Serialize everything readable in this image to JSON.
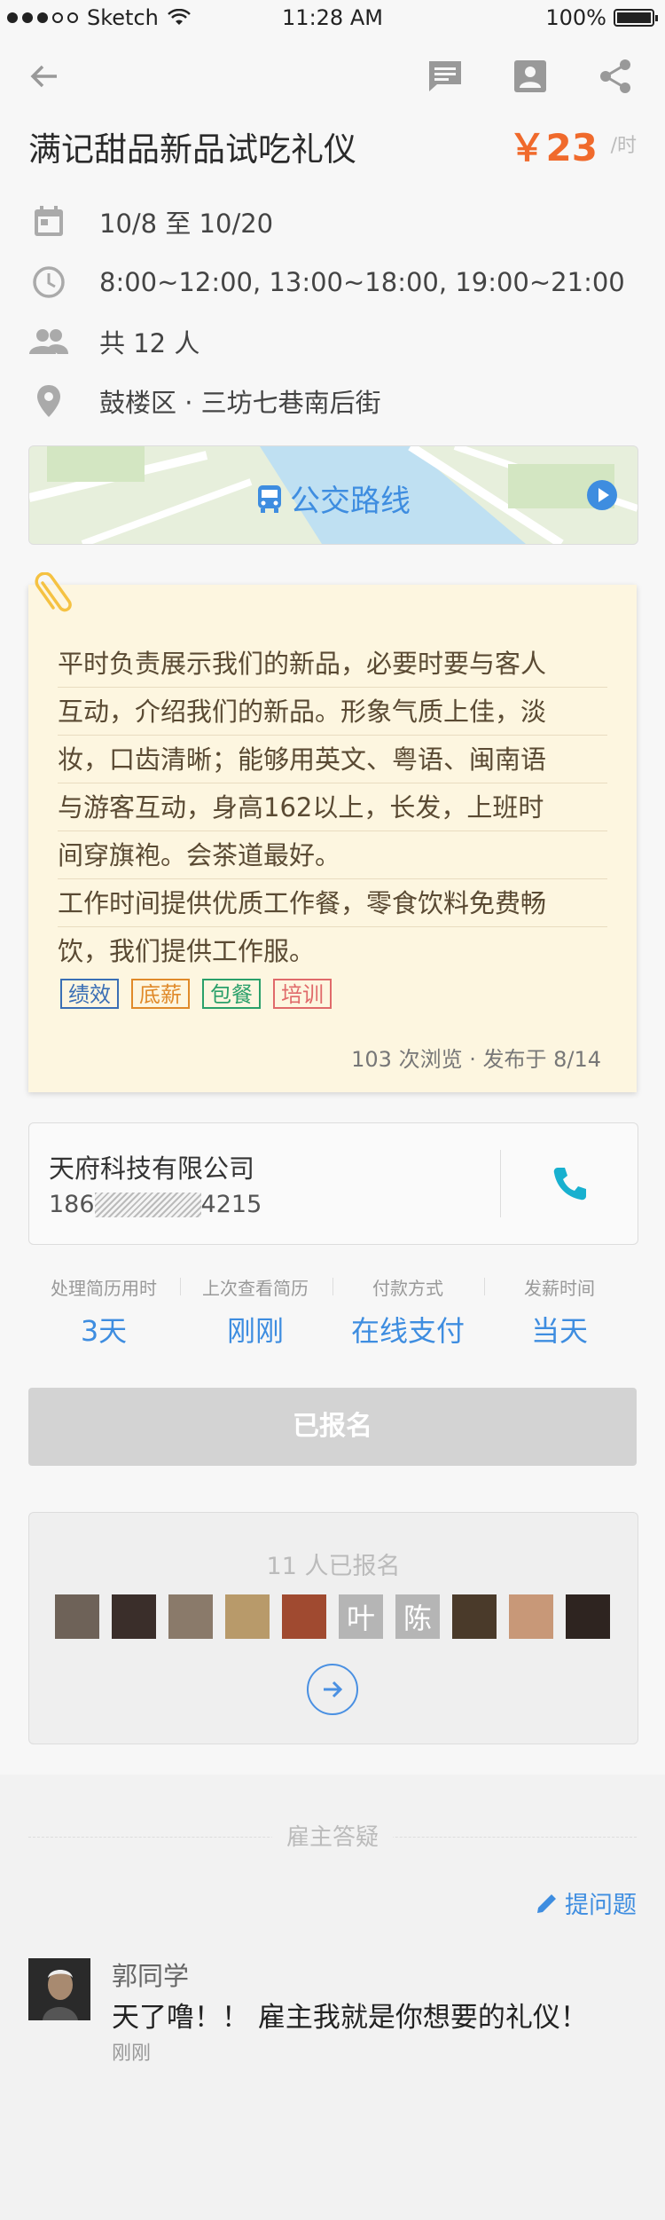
{
  "status_bar": {
    "carrier": "Sketch",
    "time": "11:28 AM",
    "battery": "100%"
  },
  "navbar": {
    "icons": [
      "back-icon",
      "message-icon",
      "contact-icon",
      "share-icon"
    ]
  },
  "job": {
    "title": "满记甜品新品试吃礼仪",
    "price": "￥23",
    "price_unit": "/时",
    "date_range": "10/8 至 10/20",
    "hours": "8:00~12:00, 13:00~18:00, 19:00~21:00",
    "headcount": "共 12 人",
    "location": "鼓楼区 · 三坊七巷南后街"
  },
  "map": {
    "label": "公交路线"
  },
  "description": {
    "lines": [
      "平时负责展示我们的新品，必要时要与客人",
      "互动，介绍我们的新品。形象气质上佳，淡",
      "妆，口齿清晰；能够用英文、粤语、闽南语",
      "与游客互动，身高162以上，长发，上班时",
      "间穿旗袍。会茶道最好。",
      "工作时间提供优质工作餐，零食饮料免费畅",
      "饮，我们提供工作服。"
    ],
    "tags": [
      {
        "label": "绩效",
        "color": "#3a6fb5"
      },
      {
        "label": "底薪",
        "color": "#e08a2a"
      },
      {
        "label": "包餐",
        "color": "#2aa06a"
      },
      {
        "label": "培训",
        "color": "#e06a6a"
      }
    ],
    "meta": "103 次浏览 · 发布于 8/14"
  },
  "company": {
    "name": "天府科技有限公司",
    "phone_prefix": "186",
    "phone_suffix": "4215"
  },
  "stats": [
    {
      "label": "处理简历用时",
      "value": "3天"
    },
    {
      "label": "上次查看简历",
      "value": "刚刚"
    },
    {
      "label": "付款方式",
      "value": "在线支付"
    },
    {
      "label": "发薪时间",
      "value": "当天"
    }
  ],
  "apply_button": "已报名",
  "applicants": {
    "count_text": "11 人已报名",
    "avatars": [
      {
        "type": "photo",
        "color": "#6e6258"
      },
      {
        "type": "photo",
        "color": "#3a2e2a"
      },
      {
        "type": "photo",
        "color": "#8a7a6a"
      },
      {
        "type": "photo",
        "color": "#b89a6a"
      },
      {
        "type": "photo",
        "color": "#a04a30"
      },
      {
        "type": "text",
        "label": "叶",
        "color": "#b5b5b5"
      },
      {
        "type": "text",
        "label": "陈",
        "color": "#b5b5b5"
      },
      {
        "type": "photo",
        "color": "#4a3a2a"
      },
      {
        "type": "photo",
        "color": "#c89878"
      },
      {
        "type": "photo",
        "color": "#2e2420"
      }
    ]
  },
  "qa": {
    "section_title": "雇主答疑",
    "ask_label": "提问题",
    "items": [
      {
        "name": "郭同学",
        "text": "天了噜！！ 雇主我就是你想要的礼仪！",
        "time": "刚刚"
      }
    ]
  }
}
